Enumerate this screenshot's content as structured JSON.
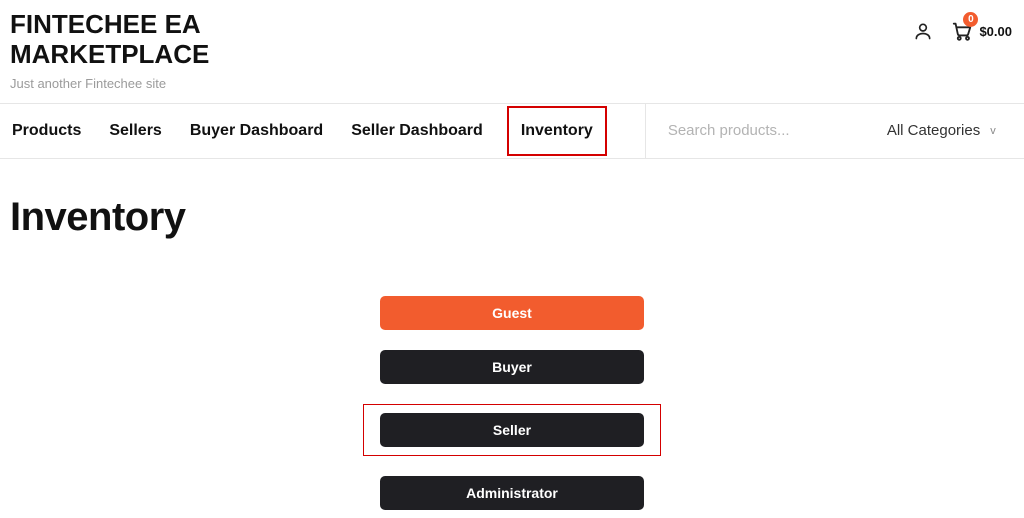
{
  "header": {
    "site_title": "FINTECHEE EA MARKETPLACE",
    "tagline": "Just another Fintechee site",
    "cart_count": "0",
    "cart_total": "$0.00"
  },
  "nav": {
    "items": [
      {
        "label": "Products"
      },
      {
        "label": "Sellers"
      },
      {
        "label": "Buyer Dashboard"
      },
      {
        "label": "Seller Dashboard"
      },
      {
        "label": "Inventory"
      }
    ]
  },
  "search": {
    "placeholder": "Search products...",
    "category_label": "All Categories"
  },
  "page": {
    "title": "Inventory"
  },
  "roles": {
    "guest": "Guest",
    "buyer": "Buyer",
    "seller": "Seller",
    "administrator": "Administrator"
  }
}
